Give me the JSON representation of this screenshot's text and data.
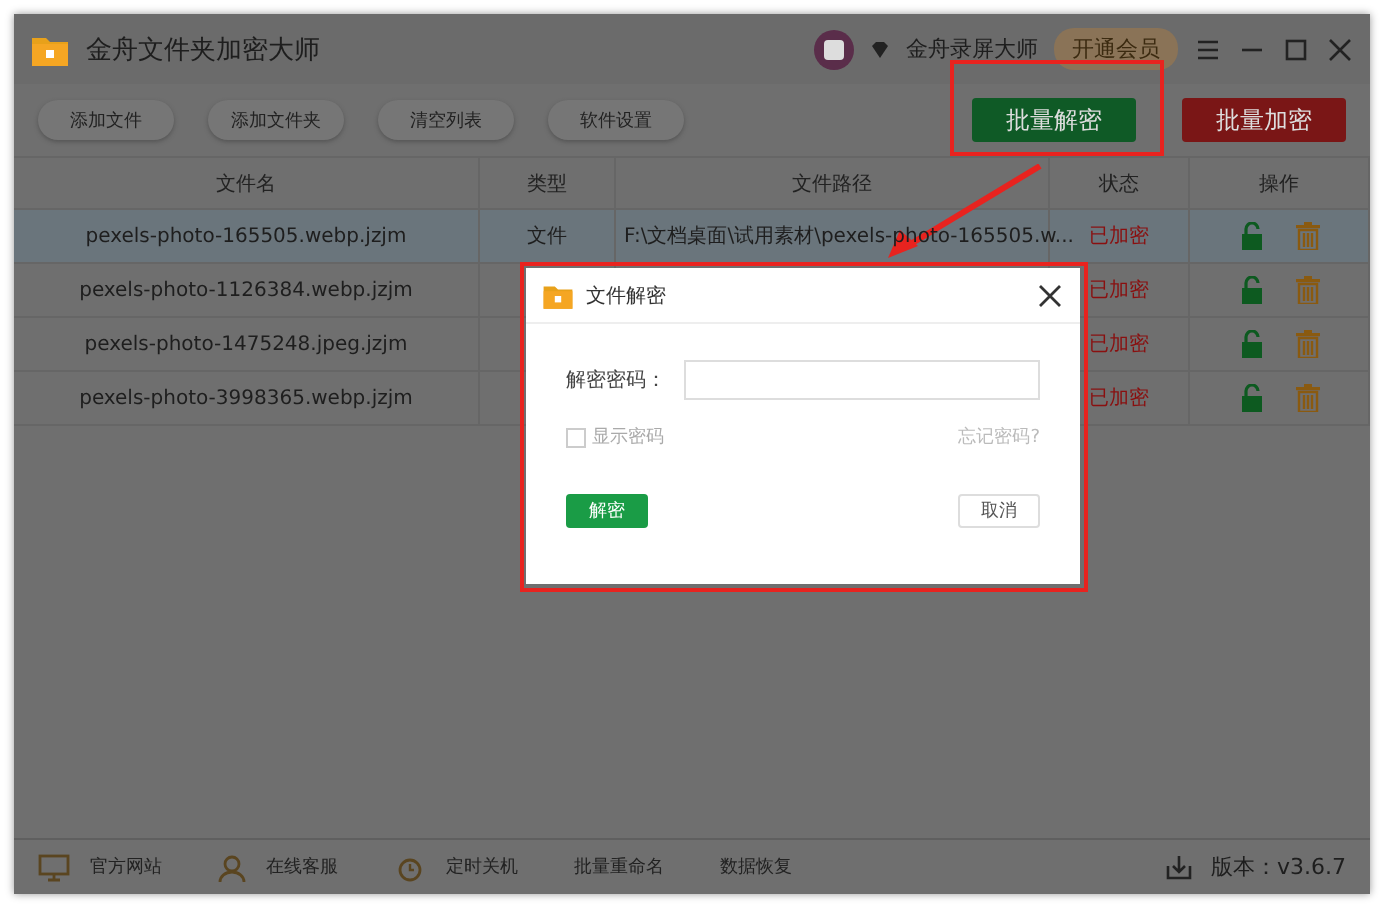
{
  "window": {
    "title": "金舟文件夹加密大师",
    "account": "金舟录屏大师",
    "vip_button": "开通会员"
  },
  "toolbar": {
    "buttons": [
      "添加文件",
      "添加文件夹",
      "清空列表",
      "软件设置"
    ],
    "decrypt_button": "批量解密",
    "encrypt_button": "批量加密"
  },
  "table": {
    "columns": [
      "文件名",
      "类型",
      "文件路径",
      "状态",
      "操作"
    ],
    "rows": [
      {
        "name": "pexels-photo-165505.webp.jzjm",
        "type": "文件",
        "path": "F:\\文档桌面\\试用素材\\pexels-photo-165505.w...",
        "status": "已加密",
        "selected": true
      },
      {
        "name": "pexels-photo-1126384.webp.jzjm",
        "status": "已加密",
        "selected": false
      },
      {
        "name": "pexels-photo-1475248.jpeg.jzjm",
        "status": "已加密",
        "selected": false
      },
      {
        "name": "pexels-photo-3998365.webp.jzjm",
        "status": "已加密",
        "selected": false
      }
    ]
  },
  "dialog": {
    "title": "文件解密",
    "password_label": "解密密码：",
    "show_password": {
      "label": "显示密码",
      "checked": false
    },
    "forgot_link": "忘记密码?",
    "confirm_button": "解密",
    "cancel_button": "取消"
  },
  "footer": {
    "links": [
      "官方网站",
      "在线客服",
      "定时关机",
      "批量重命名",
      "数据恢复"
    ],
    "version": "版本：v3.6.7"
  }
}
